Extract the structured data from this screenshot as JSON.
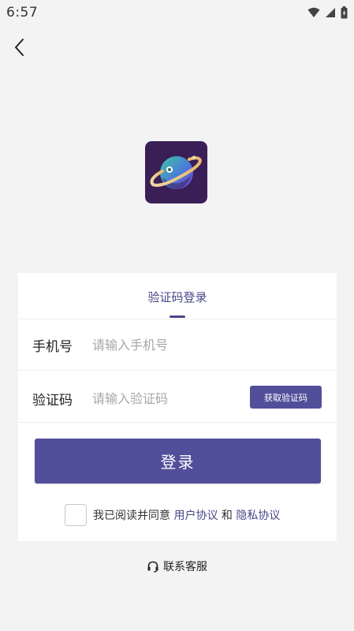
{
  "status_bar": {
    "time": "6:57"
  },
  "icons": {
    "back": "back-arrow-icon",
    "wifi": "wifi-icon",
    "signal": "signal-icon",
    "battery": "battery-icon",
    "headset": "headset-icon",
    "logo": "planet-logo"
  },
  "colors": {
    "accent": "#524f9a",
    "accent_text": "#4a4788",
    "background": "#f3f3f3"
  },
  "login_card": {
    "tab_label": "验证码登录",
    "phone": {
      "label": "手机号",
      "placeholder": "请输入手机号",
      "value": ""
    },
    "code": {
      "label": "验证码",
      "placeholder": "请输入验证码",
      "value": "",
      "button": "获取验证码"
    },
    "login_button": "登录",
    "agreement": {
      "checked": false,
      "prefix": "我已阅读并同意",
      "user_agreement": "用户协议",
      "conjunction": "和",
      "privacy_policy": "隐私协议"
    }
  },
  "contact_service": "联系客服"
}
